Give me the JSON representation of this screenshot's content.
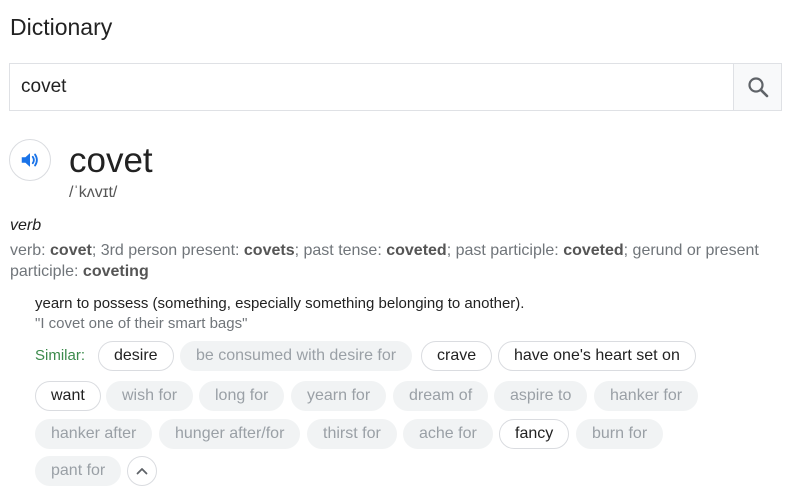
{
  "header": {
    "title": "Dictionary"
  },
  "search": {
    "value": "covet",
    "icon": "search-icon"
  },
  "entry": {
    "audio_icon": "speaker-icon",
    "word": "covet",
    "phonetic": "/ˈkʌvɪt/",
    "part_of_speech": "verb",
    "forms": {
      "prefix": "verb: ",
      "base": "covet",
      "sep1": "; 3rd person present: ",
      "third_person": "covets",
      "sep2": "; past tense: ",
      "past": "coveted",
      "sep3": "; past participle: ",
      "past_participle": "coveted",
      "sep4": "; gerund or present participle: ",
      "gerund": "coveting"
    },
    "definition": "yearn to possess (something, especially something belonging to another).",
    "example": "\"I covet one of their smart bags\"",
    "similar_label": "Similar:",
    "similar": [
      {
        "label": "desire",
        "active": true
      },
      {
        "label": "be consumed with desire for",
        "active": false
      },
      {
        "label": "crave",
        "active": true
      },
      {
        "label": "have one's heart set on",
        "active": true
      },
      {
        "label": "want",
        "active": true
      },
      {
        "label": "wish for",
        "active": false
      },
      {
        "label": "long for",
        "active": false
      },
      {
        "label": "yearn for",
        "active": false
      },
      {
        "label": "dream of",
        "active": false
      },
      {
        "label": "aspire to",
        "active": false
      },
      {
        "label": "hanker for",
        "active": false
      },
      {
        "label": "hanker after",
        "active": false
      },
      {
        "label": "hunger after/for",
        "active": false
      },
      {
        "label": "thirst for",
        "active": false
      },
      {
        "label": "ache for",
        "active": false
      },
      {
        "label": "fancy",
        "active": true
      },
      {
        "label": "burn for",
        "active": false
      },
      {
        "label": "pant for",
        "active": false
      }
    ],
    "collapse_icon": "chevron-up-icon"
  }
}
